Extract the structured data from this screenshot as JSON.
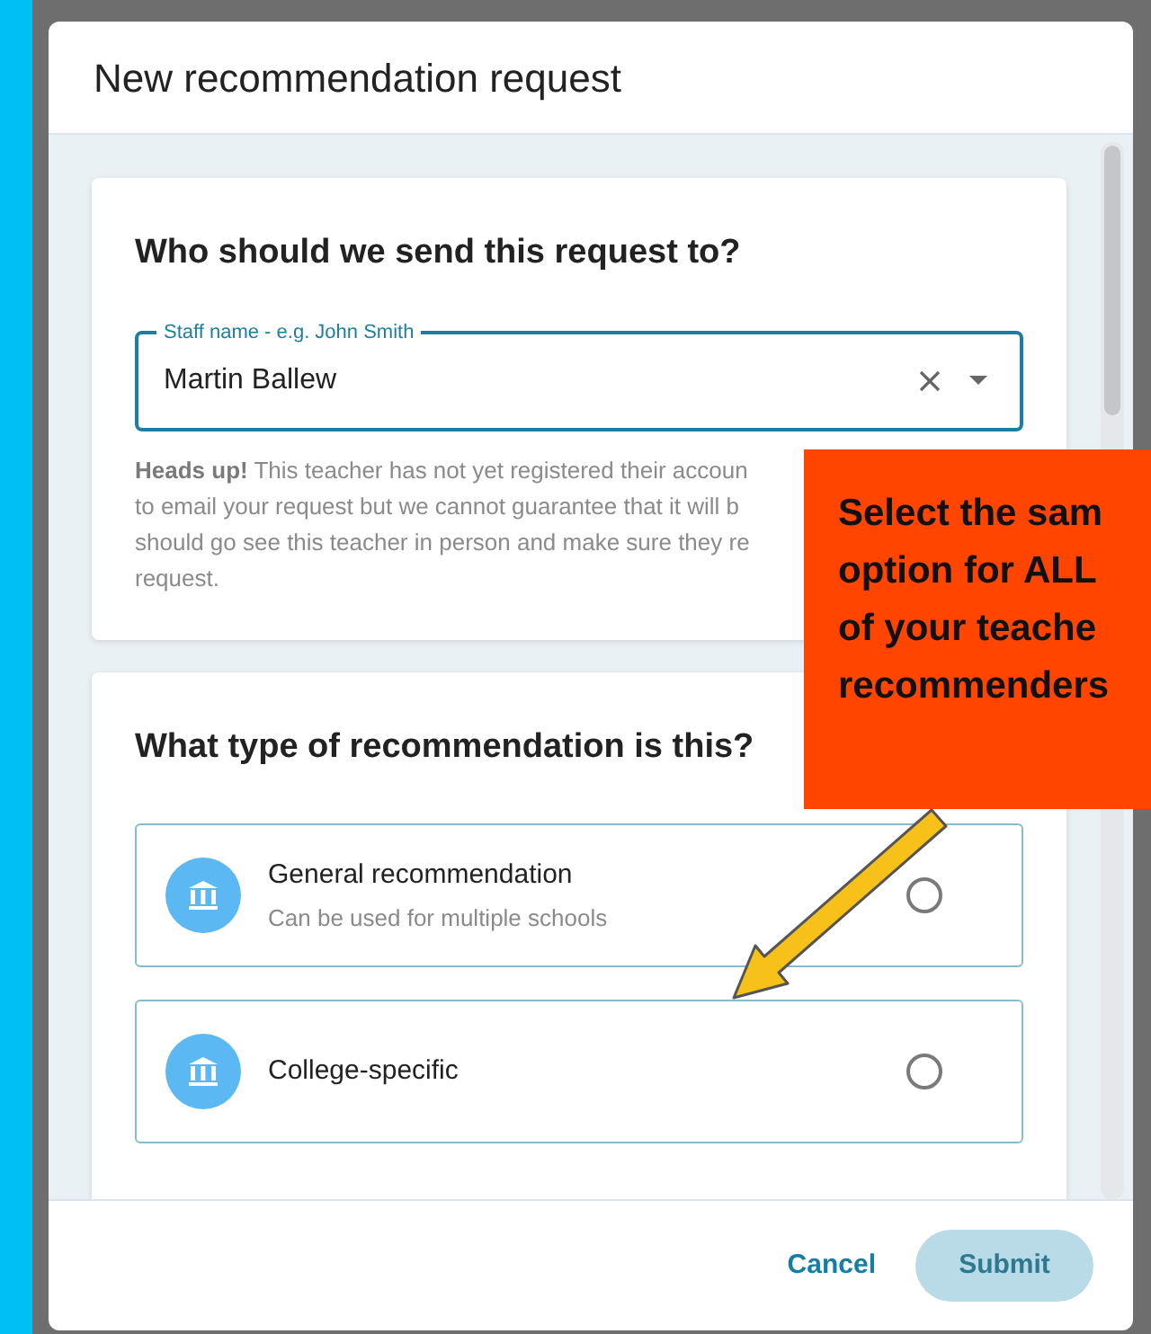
{
  "dialog": {
    "title": "New recommendation request",
    "sections": [
      {
        "kind": "recipient",
        "title": "Who should we send this request to?",
        "field": {
          "label": "Staff name - e.g. John Smith",
          "value": "Martin Ballew"
        },
        "notice_lines": [
          "**Heads up!** This teacher has not yet registered their accoun",
          "to email your request but we cannot guarantee that it will b",
          "should go see this teacher in person and make sure they re",
          "request."
        ]
      },
      {
        "kind": "type",
        "title": "What type of recommendation is this?",
        "options": [
          {
            "title": "General recommendation",
            "subtitle": "Can be used for multiple schools",
            "selected": false
          },
          {
            "title": "College-specific",
            "selected": false
          }
        ]
      }
    ],
    "buttons": [
      {
        "label": "Cancel",
        "kind": "text"
      },
      {
        "label": "Submit",
        "kind": "primary",
        "disabled": true
      }
    ]
  },
  "callout": {
    "lines": [
      "Select the sam",
      "option for ALL",
      "of your teache",
      "recommenders"
    ]
  }
}
